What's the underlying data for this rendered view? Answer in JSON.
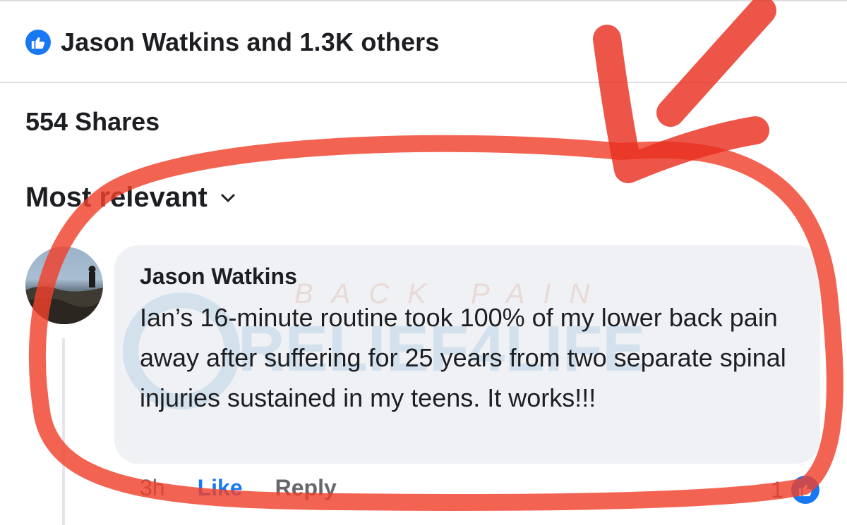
{
  "reactions": {
    "summary": "Jason Watkins and 1.3K others",
    "icon": "like-icon"
  },
  "shares": {
    "label": "554 Shares"
  },
  "sort": {
    "label": "Most relevant",
    "icon": "chevron-down-icon"
  },
  "comment": {
    "author": "Jason Watkins",
    "text": "Ian’s 16-minute routine took 100% of my lower back pain away after suffering for 25 years from two separate spinal injuries sustained in my teens. It works!!!",
    "time": "3h",
    "like_label": "Like",
    "reply_label": "Reply",
    "reaction_count": "1"
  },
  "watermark": {
    "line1": "BACK PAIN",
    "line2": "RELIEF4LIFE"
  },
  "colors": {
    "brand": "#1877f2",
    "annotation": "#f0412c",
    "bubble": "#eff1f4",
    "muted": "#65676b"
  }
}
